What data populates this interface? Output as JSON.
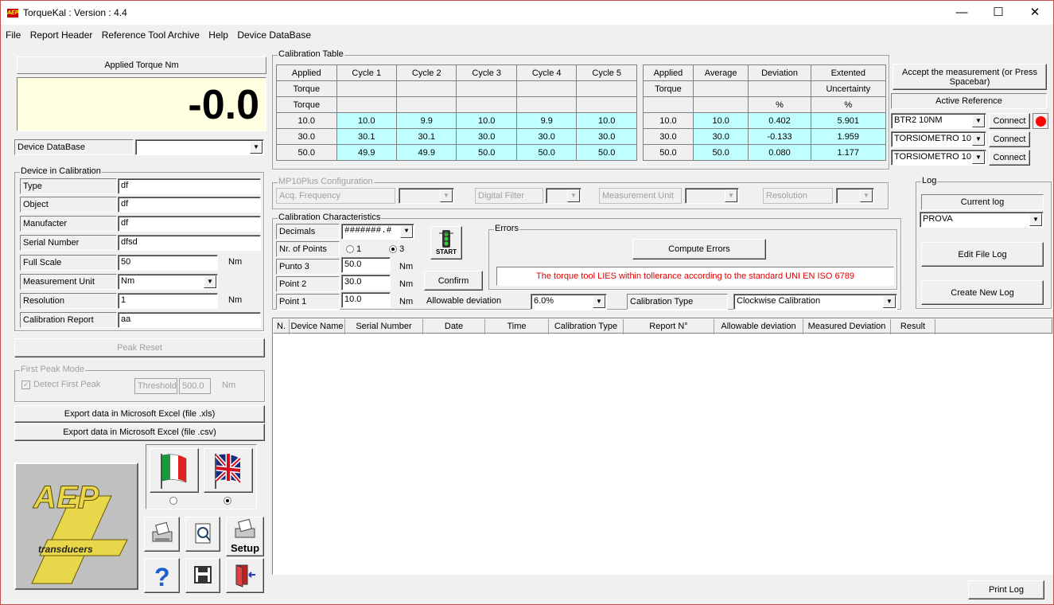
{
  "app": {
    "title": "TorqueKal : Version : 4.4",
    "icon_text": "AEP"
  },
  "window_buttons": {
    "minimize": "—",
    "maximize": "☐",
    "close": "✕"
  },
  "menu": [
    "File",
    "Report Header",
    "Reference Tool Archive",
    "Help",
    "Device DataBase"
  ],
  "torque": {
    "header": "Applied Torque Nm",
    "value": "-0.0"
  },
  "device_db": {
    "label": "Device DataBase",
    "value": ""
  },
  "device": {
    "group": "Device in Calibration",
    "fields": [
      {
        "label": "Type",
        "value": "df"
      },
      {
        "label": "Object",
        "value": "df"
      },
      {
        "label": "Manufacter",
        "value": "df"
      },
      {
        "label": "Serial Number",
        "value": "dfsd"
      },
      {
        "label": "Full Scale",
        "value": "50",
        "unit": "Nm"
      },
      {
        "label": "Measurement Unit",
        "value": "Nm"
      },
      {
        "label": "Resolution",
        "value": "1",
        "unit": "Nm"
      },
      {
        "label": "Calibration Report",
        "value": "aa"
      }
    ]
  },
  "peak_reset": "Peak Reset",
  "first_peak": {
    "group": "First Peak Mode",
    "detect": "Detect First Peak",
    "threshold_label": "Threshold",
    "threshold": "500.0",
    "unit": "Nm"
  },
  "export": {
    "xls": "Export data in Microsoft Excel (file .xls)",
    "csv": "Export data in Microsoft Excel (file .csv)"
  },
  "logo": {
    "top": "AEP",
    "bottom": "transducers"
  },
  "setup_label": "Setup",
  "calib_table": {
    "title": "Calibration Table",
    "headers1": [
      "Applied",
      "Cycle 1",
      "Cycle 2",
      "Cycle 3",
      "Cycle 4",
      "Cycle 5"
    ],
    "headers2": [
      "Torque",
      "",
      "",
      "",
      "",
      ""
    ],
    "rows": [
      [
        "10.0",
        "10.0",
        "9.9",
        "10.0",
        "9.9",
        "10.0"
      ],
      [
        "30.0",
        "30.1",
        "30.1",
        "30.0",
        "30.0",
        "30.0"
      ],
      [
        "50.0",
        "49.9",
        "49.9",
        "50.0",
        "50.0",
        "50.0"
      ]
    ],
    "r_headers1": [
      "Applied",
      "Average",
      "Deviation",
      "Extented"
    ],
    "r_headers2": [
      "Torque",
      "",
      "",
      "Uncertainty"
    ],
    "r_headers3": [
      "",
      "",
      "%",
      "%"
    ],
    "r_rows": [
      [
        "10.0",
        "10.0",
        "0.402",
        "5.901"
      ],
      [
        "30.0",
        "30.0",
        "-0.133",
        "1.959"
      ],
      [
        "50.0",
        "50.0",
        "0.080",
        "1.177"
      ]
    ]
  },
  "accept_btn": "Accept the measurement (or Press Spacebar)",
  "active_ref": {
    "label": "Active Reference",
    "items": [
      {
        "value": "BTR2 10NM",
        "btn": "Connect"
      },
      {
        "value": "TORSIOMETRO 10",
        "btn": "Connect"
      },
      {
        "value": "TORSIOMETRO 10",
        "btn": "Connect"
      }
    ],
    "status_color": "#ff0000"
  },
  "mp10": {
    "group": "MP10Plus Configuration",
    "acq": "Acq. Frequency",
    "filter": "Digital Filter",
    "unit": "Measurement Unit",
    "resolution": "Resolution"
  },
  "chars": {
    "group": "Calibration Characteristics",
    "decimals_label": "Decimals",
    "decimals": "#######.#",
    "points_label": "Nr. of Points",
    "opt1": "1",
    "opt3": "3",
    "p3_label": "Punto  3",
    "p3": "50.0",
    "p2_label": "Point  2",
    "p2": "30.0",
    "p1_label": "Point  1",
    "p1": "10.0",
    "unit": "Nm",
    "start": "START",
    "confirm": "Confirm",
    "allow_label": "Allowable deviation",
    "allow": "6.0%",
    "ctype_label": "Calibration Type",
    "ctype": "Clockwise Calibration"
  },
  "errors": {
    "group": "Errors",
    "compute": "Compute Errors",
    "message": "The torque tool LIES within tollerance according to the standard UNI EN ISO 6789"
  },
  "log": {
    "group": "Log",
    "current_label": "Current log",
    "current": "PROVA",
    "edit": "Edit File Log",
    "create": "Create New Log"
  },
  "results_headers": [
    "N.",
    "Device Name",
    "Serial Number",
    "Date",
    "Time",
    "Calibration Type",
    "Report N°",
    "Allowable deviation",
    "Measured Deviation",
    "Result"
  ],
  "print_log": "Print Log"
}
